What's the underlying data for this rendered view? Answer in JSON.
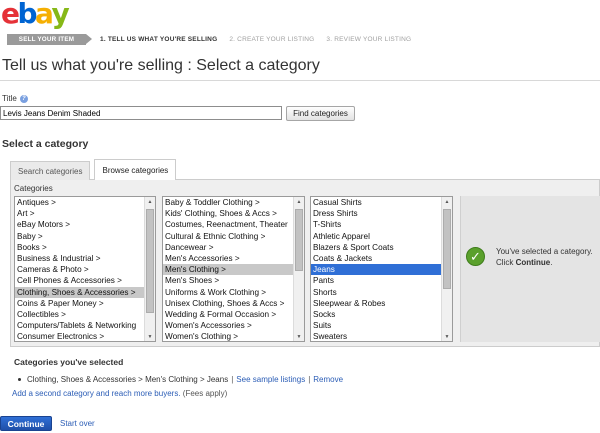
{
  "logo": {
    "letters": [
      "e",
      "b",
      "a",
      "y"
    ],
    "colors": [
      "#e53238",
      "#0064d2",
      "#f5af02",
      "#86b817"
    ]
  },
  "steps": {
    "current_pill": "SELL YOUR ITEM",
    "items": [
      "1. TELL US WHAT YOU'RE SELLING",
      "2. CREATE YOUR LISTING",
      "3. REVIEW YOUR LISTING"
    ]
  },
  "page_title": "Tell us what you're selling : Select a category",
  "title_field": {
    "label": "Title",
    "value": "Levis Jeans Denim Shaded",
    "button": "Find categories"
  },
  "select_category": {
    "heading": "Select a category",
    "tabs": [
      "Search categories",
      "Browse categories"
    ],
    "active_tab": "Browse categories",
    "categories_label": "Categories"
  },
  "lists": {
    "col1": {
      "items": [
        "Antiques >",
        "Art >",
        "eBay Motors >",
        "Baby >",
        "Books >",
        "Business & Industrial >",
        "Cameras & Photo >",
        "Cell Phones & Accessories >",
        "Clothing, Shoes & Accessories >",
        "Coins & Paper Money >",
        "Collectibles >",
        "Computers/Tablets & Networking",
        "Consumer Electronics >"
      ],
      "selected": "Clothing, Shoes & Accessories >"
    },
    "col2": {
      "items": [
        "Baby & Toddler Clothing >",
        "Kids' Clothing, Shoes & Accs >",
        "Costumes, Reenactment, Theater",
        "Cultural & Ethnic Clothing >",
        "Dancewear >",
        "Men's Accessories >",
        "Men's Clothing >",
        "Men's Shoes >",
        "Uniforms & Work Clothing >",
        "Unisex Clothing, Shoes & Accs >",
        "Wedding & Formal Occasion >",
        "Women's Accessories >",
        "Women's Clothing >"
      ],
      "selected": "Men's Clothing >"
    },
    "col3": {
      "items": [
        "Casual Shirts",
        "Dress Shirts",
        "T-Shirts",
        "Athletic Apparel",
        "Blazers & Sport Coats",
        "Coats & Jackets",
        "Jeans",
        "Pants",
        "Shorts",
        "Sleepwear & Robes",
        "Socks",
        "Suits",
        "Sweaters"
      ],
      "selected": "Jeans"
    }
  },
  "selected_panel": {
    "text_before": "You've selected a category. Click ",
    "text_bold": "Continue",
    "text_after": "."
  },
  "categories_selected": {
    "heading": "Categories you've selected",
    "path": "Clothing, Shoes & Accessories > Men's Clothing > Jeans",
    "separator": "|",
    "see_sample": "See sample listings",
    "remove": "Remove",
    "add_second": "Add a second category and reach more buyers.",
    "fees": "(Fees apply)"
  },
  "footer": {
    "continue": "Continue",
    "start_over": "Start over"
  }
}
